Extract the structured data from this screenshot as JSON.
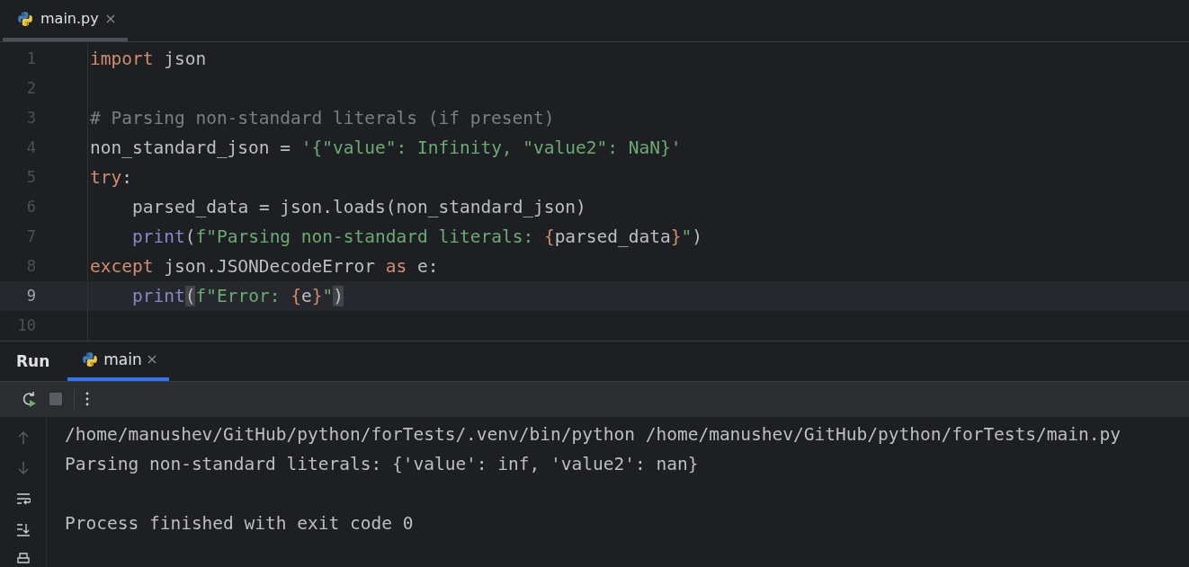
{
  "editor_tabs": [
    {
      "label": "main.py",
      "selected": true
    }
  ],
  "editor": {
    "lines": [
      {
        "number": "1",
        "current": false,
        "indented": false,
        "tokens": [
          {
            "kind": "keyword",
            "text": "import"
          },
          {
            "kind": "plain",
            "text": " json"
          }
        ]
      },
      {
        "number": "2",
        "current": false
      },
      {
        "number": "3",
        "current": false,
        "indented": false,
        "tokens": [
          {
            "kind": "comment",
            "text": "# Parsing non-standard literals (if present)"
          }
        ]
      },
      {
        "number": "4",
        "current": false,
        "indented": false,
        "tokens": [
          {
            "kind": "plain",
            "text": "non_standard_json = "
          },
          {
            "kind": "string",
            "text": "'{\"value\": Infinity, \"value2\": NaN}'"
          }
        ]
      },
      {
        "number": "5",
        "current": false,
        "indented": false,
        "tokens": [
          {
            "kind": "keyword",
            "text": "try"
          },
          {
            "kind": "plain",
            "text": ":"
          }
        ]
      },
      {
        "number": "6",
        "current": false,
        "indented": true,
        "tokens": [
          {
            "kind": "plain",
            "text": "parsed_data = json.loads(non_standard_json)"
          }
        ]
      },
      {
        "number": "7",
        "current": false,
        "indented": true,
        "tokens": [
          {
            "kind": "builtin",
            "text": "print"
          },
          {
            "kind": "plain",
            "text": "("
          },
          {
            "kind": "string",
            "text": "f\"Parsing non-standard literals: "
          },
          {
            "kind": "brace",
            "text": "{"
          },
          {
            "kind": "plain",
            "text": "parsed_data"
          },
          {
            "kind": "brace",
            "text": "}"
          },
          {
            "kind": "string",
            "text": "\""
          },
          {
            "kind": "plain",
            "text": ")"
          }
        ]
      },
      {
        "number": "8",
        "current": false,
        "indented": false,
        "tokens": [
          {
            "kind": "keyword",
            "text": "except"
          },
          {
            "kind": "plain",
            "text": " json.JSONDecodeError "
          },
          {
            "kind": "keyword",
            "text": "as"
          },
          {
            "kind": "plain",
            "text": " e:"
          }
        ]
      },
      {
        "number": "9",
        "current": true,
        "indented": true,
        "tokens": [
          {
            "kind": "builtin",
            "text": "print"
          },
          {
            "kind": "match",
            "text": "("
          },
          {
            "kind": "string",
            "text": "f\"Error: "
          },
          {
            "kind": "brace",
            "text": "{"
          },
          {
            "kind": "plain",
            "text": "e"
          },
          {
            "kind": "brace",
            "text": "}"
          },
          {
            "kind": "string",
            "text": "\""
          },
          {
            "kind": "match",
            "text": ")"
          }
        ]
      },
      {
        "number": "10",
        "current": false
      }
    ]
  },
  "run_panel": {
    "title": "Run",
    "tabs": [
      {
        "label": "main",
        "selected": true
      }
    ],
    "console": [
      {
        "kind": "output",
        "text": "/home/manushev/GitHub/python/forTests/.venv/bin/python /home/manushev/GitHub/python/forTests/main.py"
      },
      {
        "kind": "output",
        "text": "Parsing non-standard literals: {'value': inf, 'value2': nan}"
      },
      {
        "kind": "blank"
      },
      {
        "kind": "output",
        "text": "Process finished with exit code 0"
      }
    ]
  }
}
